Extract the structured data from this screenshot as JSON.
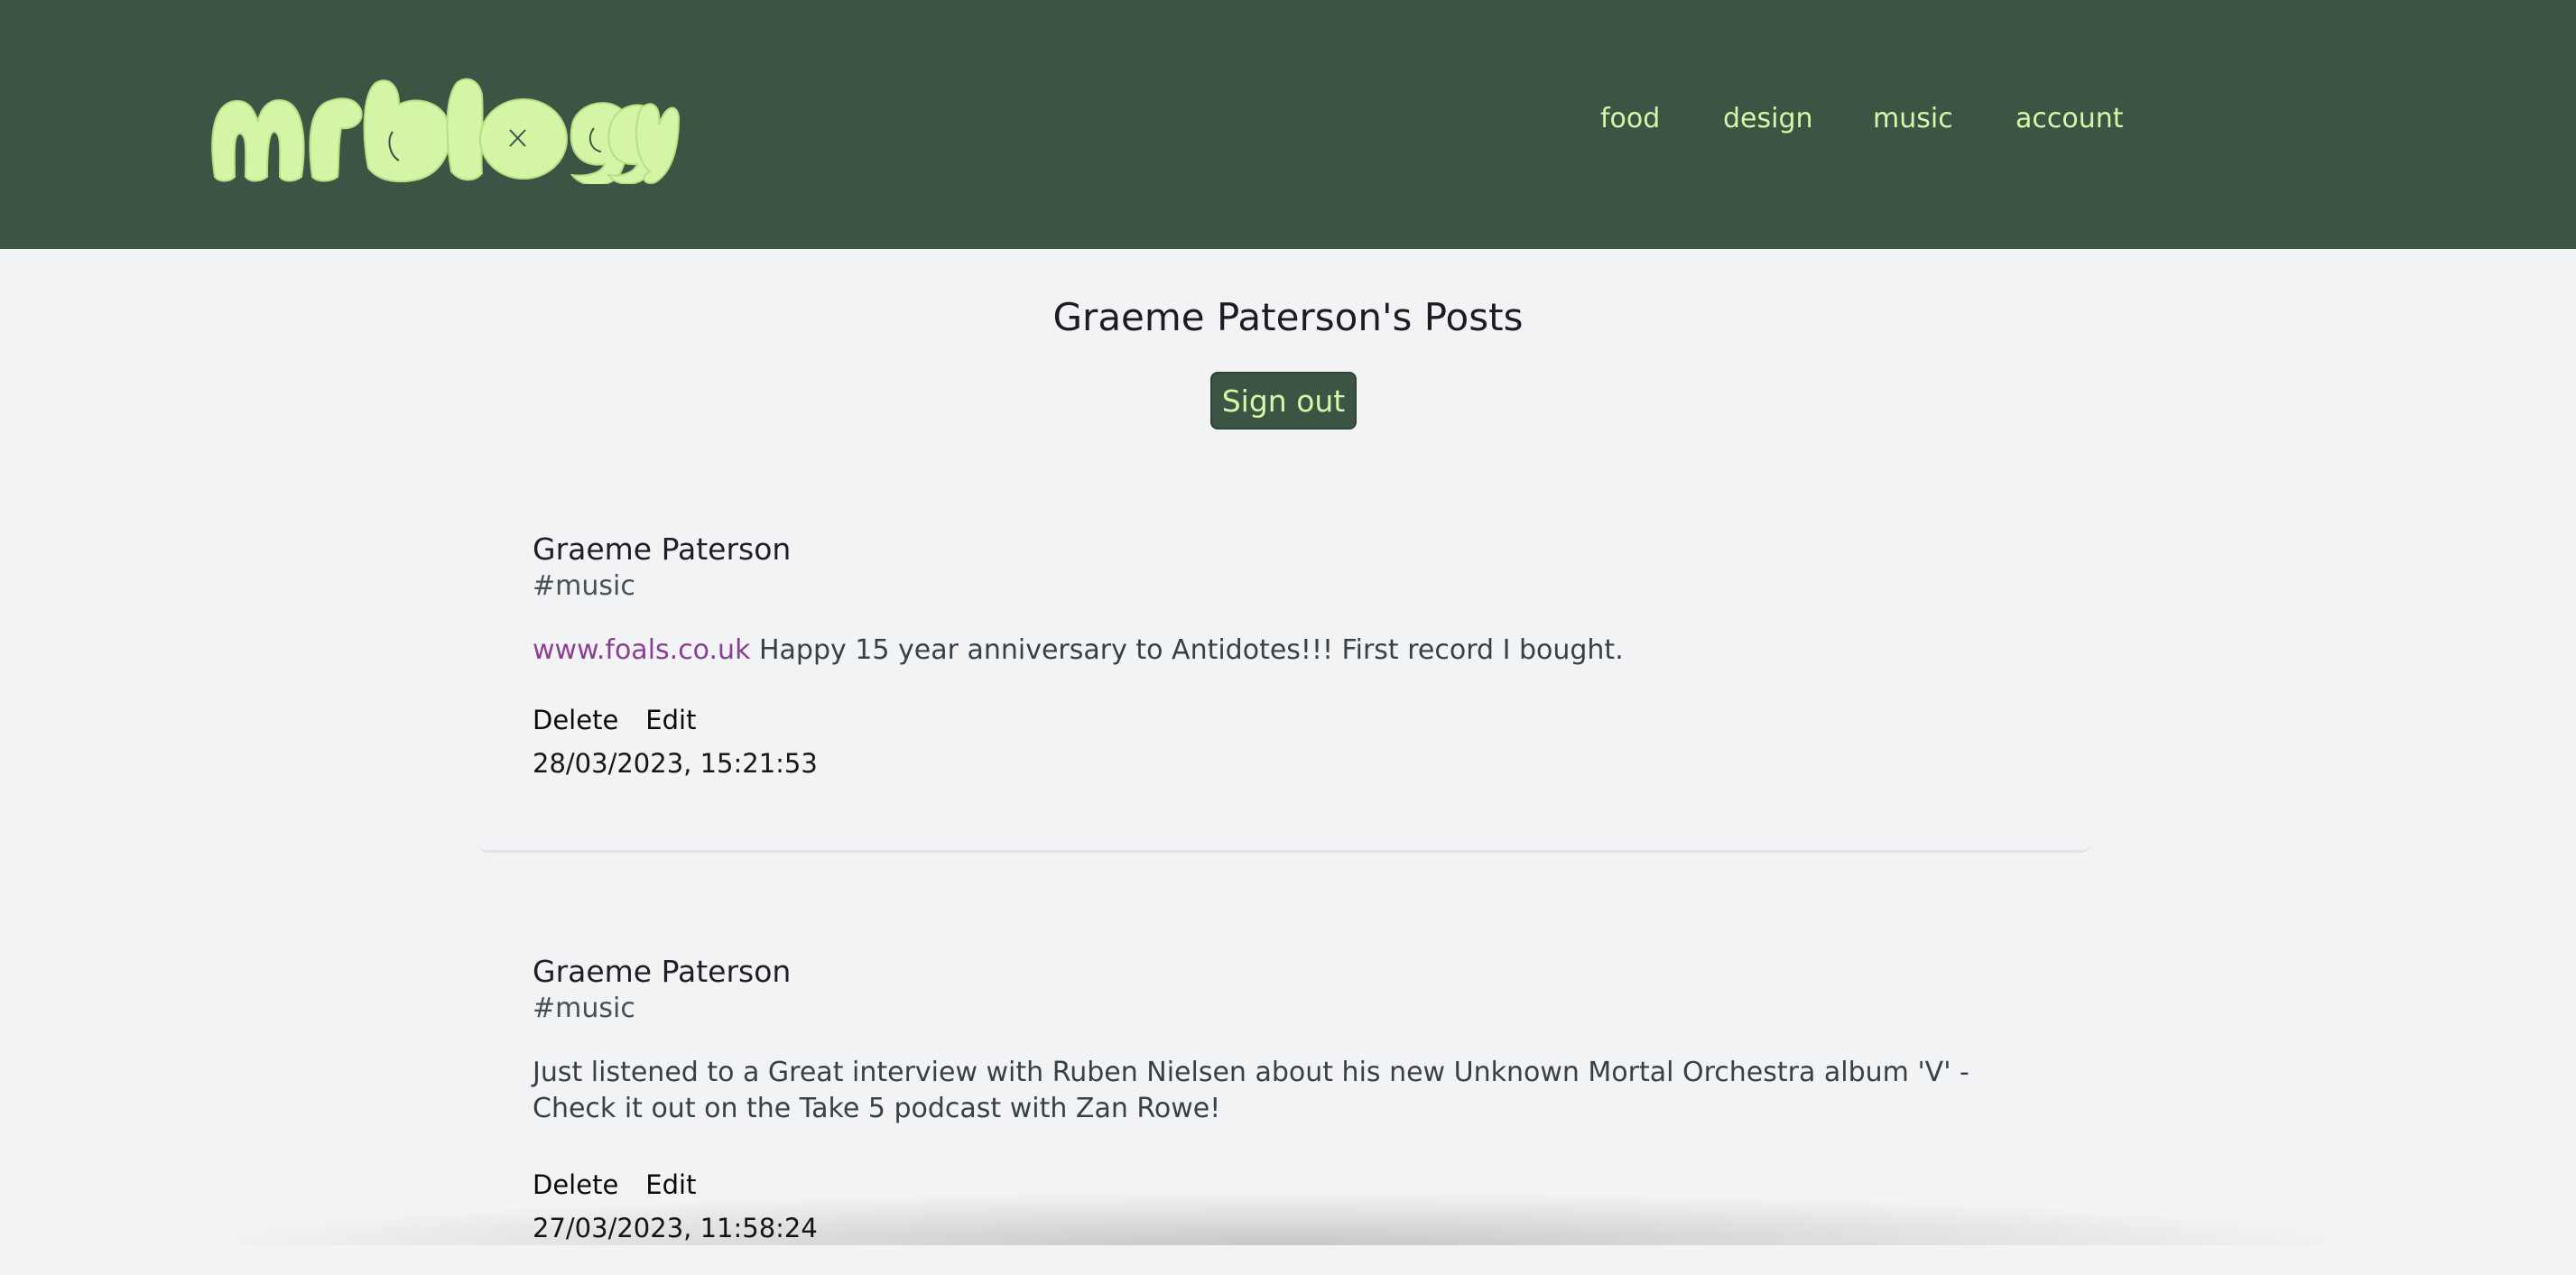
{
  "header": {
    "logo_text": "mr bloggy",
    "nav": [
      "food",
      "design",
      "music",
      "account"
    ]
  },
  "page": {
    "title": "Graeme Paterson's Posts",
    "signout_label": "Sign out"
  },
  "posts": [
    {
      "author": "Graeme Paterson",
      "tag": "#music",
      "link": "www.foals.co.uk",
      "text": " Happy 15 year anniversary to Antidotes!!! First record I bought.",
      "delete_label": "Delete",
      "edit_label": "Edit",
      "date": "28/03/2023, 15:21:53"
    },
    {
      "author": "Graeme Paterson",
      "tag": "#music",
      "text": "Just listened to a Great interview with Ruben Nielsen about his new Unknown Mortal Orchestra album 'V' - Check it out on the Take 5 podcast with Zan Rowe!",
      "delete_label": "Delete",
      "edit_label": "Edit",
      "date": "27/03/2023, 11:58:24"
    }
  ],
  "colors": {
    "header_bg": "#3c5444",
    "accent": "#d6f6a8",
    "link": "#8a3f92",
    "page_bg": "#f2f3f5"
  }
}
